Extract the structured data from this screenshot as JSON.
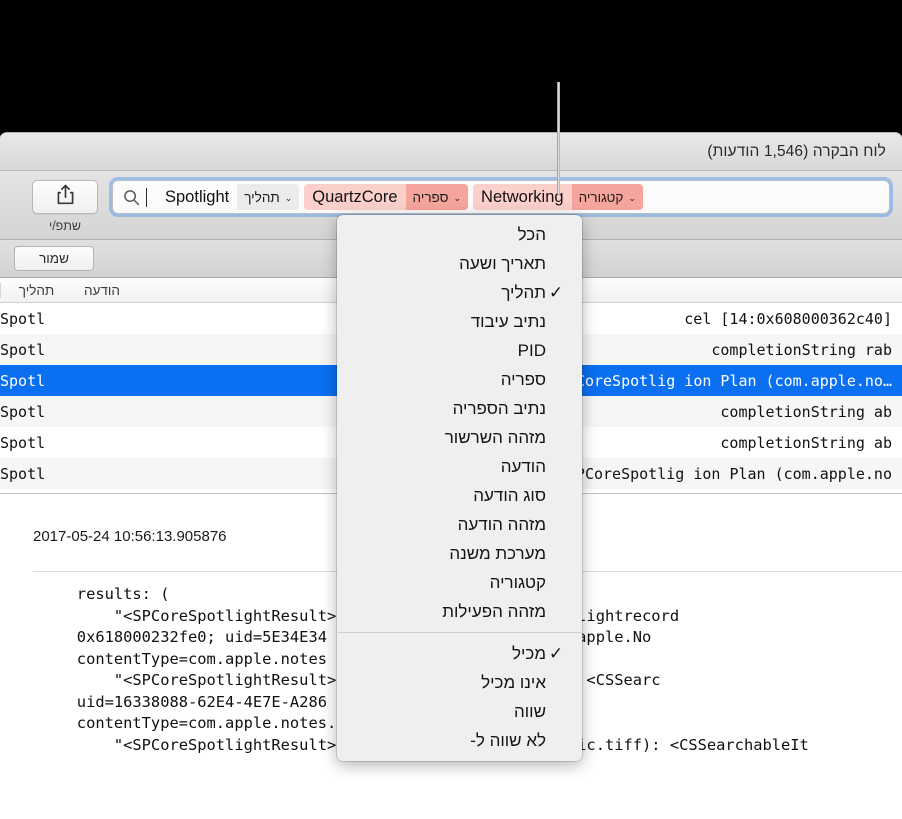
{
  "window": {
    "title": "לוח הבקרה (1,546 הודעות)"
  },
  "toolbar": {
    "share_label": "שתפ/י",
    "share_icon": "share-icon",
    "search_icon": "search-icon",
    "search_value": "Spotlight",
    "tokens": [
      {
        "key": "תהליך",
        "value": "Spotlight",
        "style": "plain",
        "chevron": "⌄"
      },
      {
        "key": "ספריה",
        "value": "QuartzCore",
        "style": "pill",
        "chevron": "⌄"
      },
      {
        "key": "קטגוריה",
        "value": "Networking",
        "style": "pill",
        "chevron": "⌄"
      }
    ]
  },
  "filter_bar": {
    "save_label": "שמור"
  },
  "table": {
    "columns": {
      "process": "תהליך",
      "message": "הודעה"
    },
    "rows": [
      {
        "process": "Spotl",
        "message": "cel [14:0x608000362c40]",
        "selected": false,
        "alt": false
      },
      {
        "process": "Spotl",
        "message": "completionString rab",
        "selected": false,
        "alt": true
      },
      {
        "process": "Spotl",
        "message": "results: (      \"<SPCoreSpotlig           ion Plan (com.apple.no…",
        "selected": true,
        "alt": false
      },
      {
        "process": "Spotl",
        "message": "completionString ab",
        "selected": false,
        "alt": true
      },
      {
        "process": "Spotl",
        "message": "completionString ab",
        "selected": false,
        "alt": false
      },
      {
        "process": "Spotl",
        "message": "results: (      \"<SPCoreSpotlig           ion Plan (com.apple.no",
        "selected": false,
        "alt": true
      }
    ]
  },
  "detail": {
    "timestamp": "2017-05-24 10:56:13.905876",
    "body": "   results: (\n       \"<SPCoreSpotlightResult> ... (com.apple.notes.spotlightrecord\n   0x618000232fe0; uid=5E34E34 ... 3C0C901, bundleID=com.apple.No\n   contentType=com.apple.notes ...\n       \"<SPCoreSpotlightResult> ... tes.spotlightrecord): <CSSearc\n   uid=16338088-62E4-4E7E-A286 ... D=com.apple.Notes,\n   contentType=com.apple.notes.\n       \"<SPCoreSpotlightResult> Pasted Graphic.tiff (public.tiff): <CSSearchableIt"
  },
  "filter_menu": {
    "groups": [
      {
        "items": [
          {
            "label": "הכל",
            "checked": false
          },
          {
            "label": "תאריך ושעה",
            "checked": false
          },
          {
            "label": "תהליך",
            "checked": true
          },
          {
            "label": "נתיב עיבוד",
            "checked": false
          },
          {
            "label": "PID",
            "checked": false
          },
          {
            "label": "ספריה",
            "checked": false
          },
          {
            "label": "נתיב הספריה",
            "checked": false
          },
          {
            "label": "מזהה השרשור",
            "checked": false
          },
          {
            "label": "הודעה",
            "checked": false
          },
          {
            "label": "סוג הודעה",
            "checked": false
          },
          {
            "label": "מזהה הודעה",
            "checked": false
          },
          {
            "label": "מערכת משנה",
            "checked": false
          },
          {
            "label": "קטגוריה",
            "checked": false
          },
          {
            "label": "מזהה הפעילות",
            "checked": false
          }
        ]
      },
      {
        "items": [
          {
            "label": "מכיל",
            "checked": true
          },
          {
            "label": "אינו מכיל",
            "checked": false
          },
          {
            "label": "שווה",
            "checked": false
          },
          {
            "label": "לא שווה ל-",
            "checked": false
          }
        ]
      }
    ],
    "check_glyph": "✓"
  },
  "colors": {
    "selection_blue": "#0a6ff0",
    "focus_ring": "#65a0e8",
    "token_key_pink": "#f5a59b",
    "token_val_pink": "#fbd0ca",
    "token_plain_gray": "#ebebeb",
    "backdrop": "#000000"
  }
}
